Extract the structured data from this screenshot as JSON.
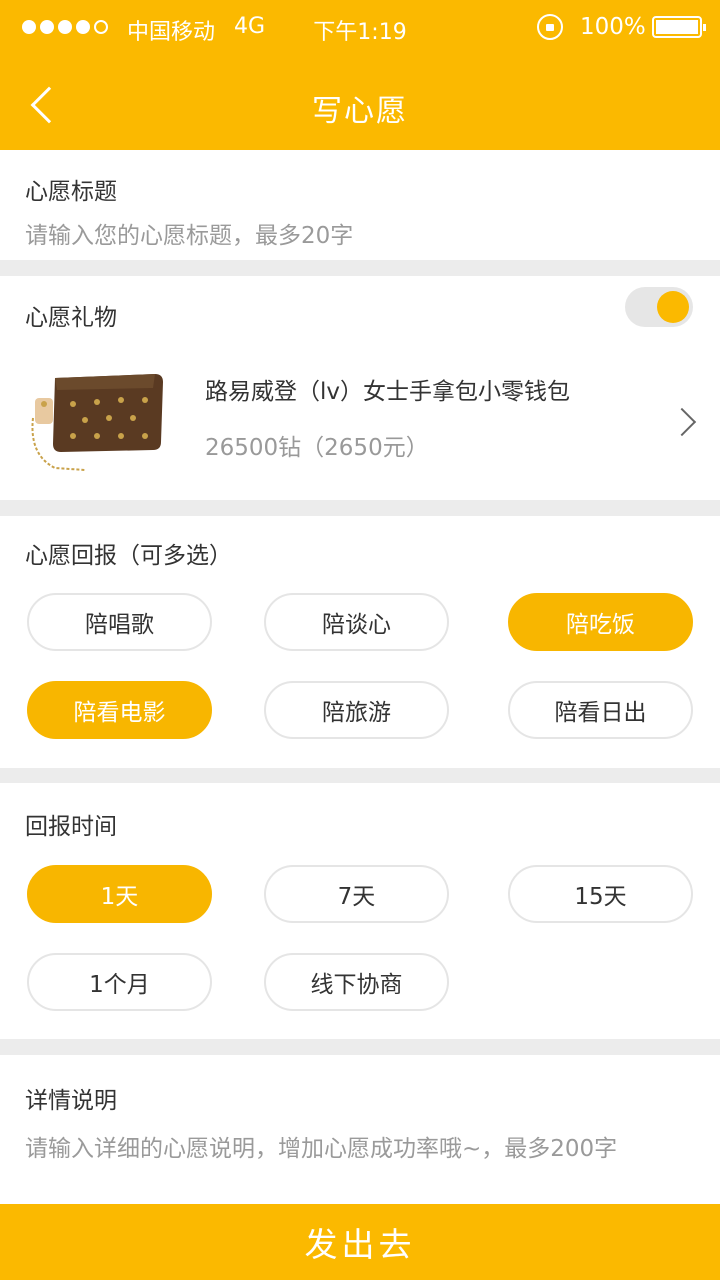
{
  "status_bar": {
    "carrier": "中国移动",
    "network": "4G",
    "time": "下午1:19",
    "battery": "100%"
  },
  "nav": {
    "title": "写心愿"
  },
  "wish_title": {
    "label": "心愿标题",
    "placeholder": "请输入您的心愿标题，最多20字"
  },
  "wish_gift": {
    "label": "心愿礼物",
    "toggle_on": true,
    "gift_name": "路易威登（lv）女士手拿包小零钱包",
    "gift_price": "26500钻（2650元）"
  },
  "reward": {
    "label": "心愿回报（可多选）",
    "options": [
      {
        "label": "陪唱歌",
        "selected": false
      },
      {
        "label": "陪谈心",
        "selected": false
      },
      {
        "label": "陪吃饭",
        "selected": true
      },
      {
        "label": "陪看电影",
        "selected": true
      },
      {
        "label": "陪旅游",
        "selected": false
      },
      {
        "label": "陪看日出",
        "selected": false
      }
    ]
  },
  "reward_time": {
    "label": "回报时间",
    "options": [
      {
        "label": "1天",
        "selected": true
      },
      {
        "label": "7天",
        "selected": false
      },
      {
        "label": "15天",
        "selected": false
      },
      {
        "label": "1个月",
        "selected": false
      },
      {
        "label": "线下协商",
        "selected": false
      }
    ]
  },
  "details": {
    "label": "详情说明",
    "placeholder": "请输入详细的心愿说明，增加心愿成功率哦~，最多200字"
  },
  "submit_label": "发出去",
  "colors": {
    "accent": "#fbb900",
    "background": "#ececec"
  }
}
